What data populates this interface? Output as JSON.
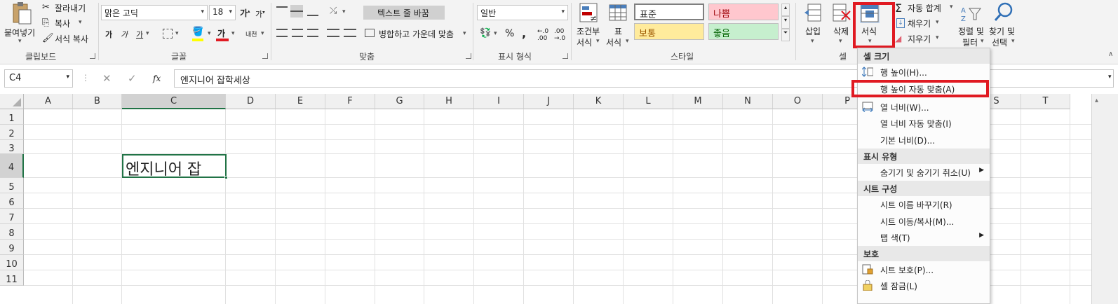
{
  "clipboard": {
    "paste": "붙여넣기",
    "cut": "잘라내기",
    "copy": "복사",
    "format_painter": "서식 복사",
    "group": "클립보드"
  },
  "font": {
    "name": "맑은 고딕",
    "size": "18",
    "group": "글꼴",
    "bold": "가",
    "italic": "가",
    "underline": "가",
    "font_color": "가",
    "phonetic": "내천"
  },
  "alignment": {
    "wrap": "텍스트 줄 바꿈",
    "merge": "병합하고 가운데 맞춤",
    "group": "맞춤"
  },
  "number": {
    "format": "일반",
    "group": "표시 형식",
    "percent": "%",
    "comma": ","
  },
  "styles": {
    "conditional": [
      "조건부",
      "서식"
    ],
    "table": [
      "표",
      "서식"
    ],
    "cells": [
      "표준",
      "나쁨",
      "보통",
      "좋음"
    ],
    "group": "스타일"
  },
  "cells": {
    "insert": "삽입",
    "delete": "삭제",
    "format": "서식",
    "group": "셀"
  },
  "editing": {
    "autosum": "자동 합계",
    "fill": "채우기",
    "clear": "지우기",
    "sort": [
      "정렬 및",
      "필터"
    ],
    "find": [
      "찾기 및",
      "선택"
    ]
  },
  "formula_bar": {
    "name_box": "C4",
    "fx": "fx",
    "content": "엔지니어 잡학세상"
  },
  "columns": [
    "A",
    "B",
    "C",
    "D",
    "E",
    "F",
    "G",
    "H",
    "I",
    "J",
    "K",
    "L",
    "M",
    "N",
    "O",
    "P",
    "S",
    "T"
  ],
  "rows": [
    "1",
    "2",
    "3",
    "4",
    "5",
    "6",
    "7",
    "8",
    "9",
    "10",
    "11"
  ],
  "cell_c4": "엔지니어 잡",
  "menu": {
    "sec1": "셀 크기",
    "row_height": "행 높이(H)...",
    "autofit_row": "행 높이 자동 맞춤(A)",
    "col_width": "열 너비(W)...",
    "autofit_col": "열 너비 자동 맞춤(I)",
    "default_width": "기본 너비(D)...",
    "sec2": "표시 유형",
    "hide_unhide": "숨기기 및 숨기기 취소(U)",
    "sec3": "시트 구성",
    "rename": "시트 이름 바꾸기(R)",
    "move_copy": "시트 이동/복사(M)...",
    "tab_color": "탭 색(T)",
    "sec4": "보호",
    "protect": "시트 보호(P)...",
    "lock": "셀 잠금(L)"
  },
  "colors": {
    "highlight_red": "#e01a22",
    "bad_bg": "#ffc7ce",
    "bad_fg": "#9c0006",
    "neutral_bg": "#ffeb9c",
    "neutral_fg": "#9c5700",
    "good_bg": "#c6efce",
    "good_fg": "#006100",
    "selection": "#217346"
  }
}
